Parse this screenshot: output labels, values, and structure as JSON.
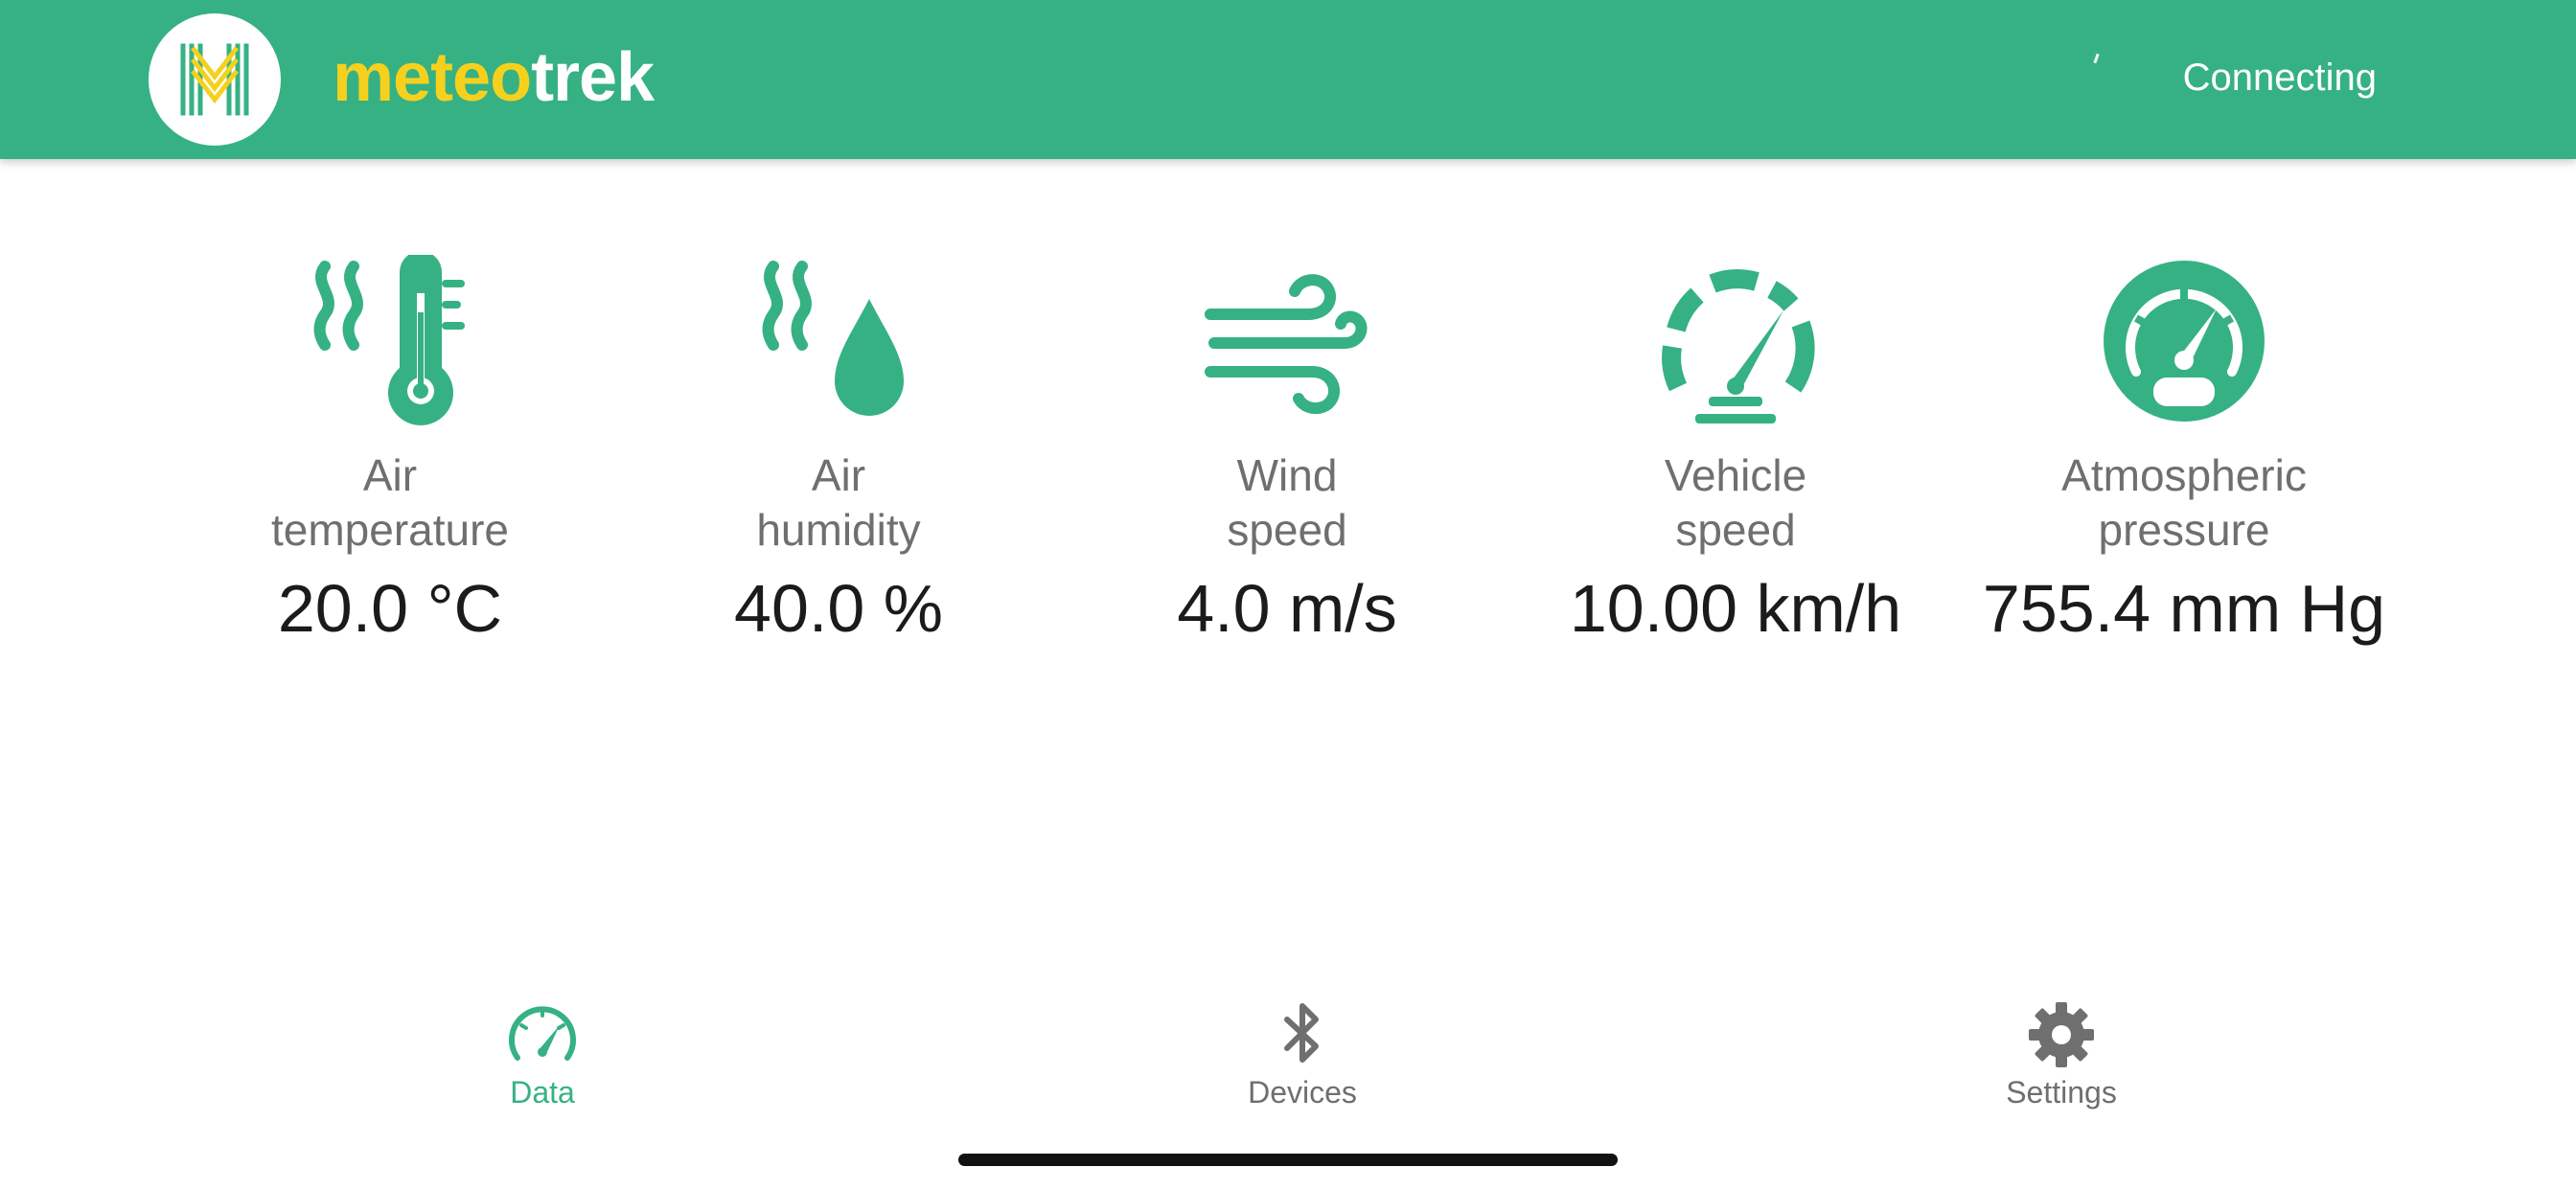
{
  "header": {
    "brand_part1": "meteo",
    "brand_part2": "trek",
    "status": "Connecting",
    "colors": {
      "bar": "#36b183",
      "brand_yellow": "#f5d11e"
    }
  },
  "metrics": [
    {
      "label": "Air\ntemperature",
      "value": "20.0 °C",
      "icon": "thermometer-icon"
    },
    {
      "label": "Air\nhumidity",
      "value": "40.0 %",
      "icon": "humidity-drop-icon"
    },
    {
      "label": "Wind\nspeed",
      "value": "4.0 m/s",
      "icon": "wind-icon"
    },
    {
      "label": "Vehicle\nspeed",
      "value": "10.00 km/h",
      "icon": "speedometer-icon"
    },
    {
      "label": "Atmospheric\npressure",
      "value": "755.4 mm Hg",
      "icon": "gauge-icon"
    }
  ],
  "tabs": [
    {
      "label": "Data",
      "icon": "speedometer-icon",
      "active": true
    },
    {
      "label": "Devices",
      "icon": "bluetooth-icon",
      "active": false
    },
    {
      "label": "Settings",
      "icon": "gear-icon",
      "active": false
    }
  ],
  "colors": {
    "accent": "#36b183",
    "label_gray": "#6f6f6f",
    "value_dark": "#1b1b1b",
    "tab_inactive": "#6f6f6f"
  }
}
